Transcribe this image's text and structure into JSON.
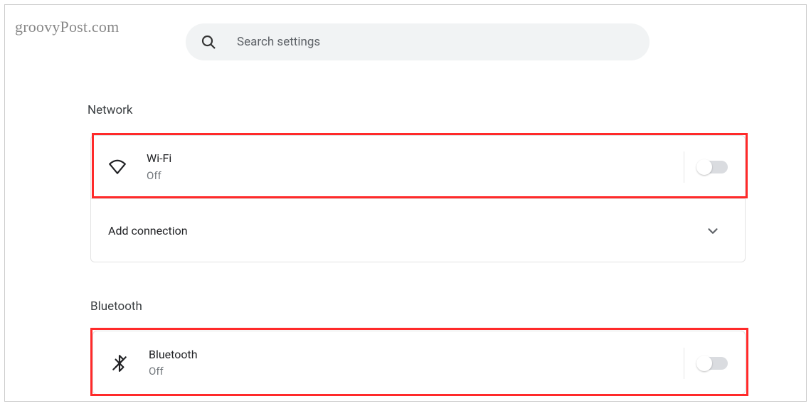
{
  "watermark": "groovyPost.com",
  "search": {
    "placeholder": "Search settings"
  },
  "sections": {
    "network": {
      "heading": "Network",
      "wifi": {
        "title": "Wi-Fi",
        "status": "Off"
      },
      "add_connection": {
        "label": "Add connection"
      }
    },
    "bluetooth": {
      "heading": "Bluetooth",
      "item": {
        "title": "Bluetooth",
        "status": "Off"
      }
    }
  }
}
